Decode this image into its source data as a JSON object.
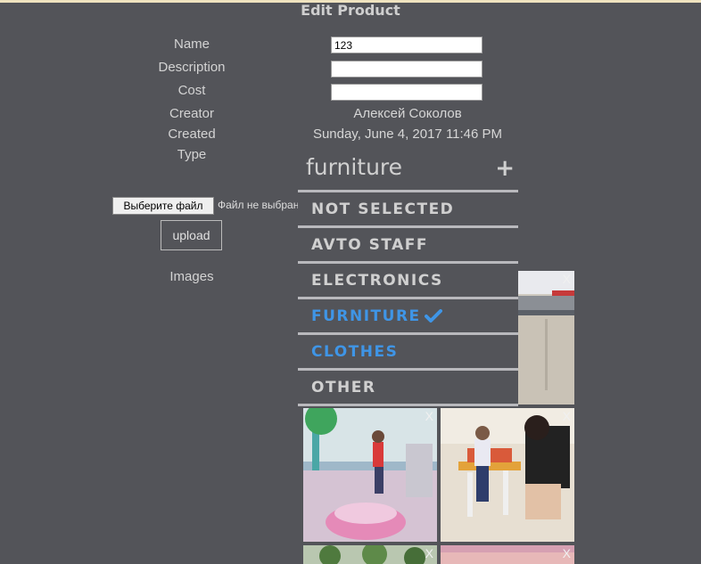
{
  "page": {
    "title": "Edit Product"
  },
  "form": {
    "name_label": "Name",
    "name_value": "123",
    "description_label": "Description",
    "description_value": "",
    "cost_label": "Cost",
    "cost_value": "",
    "creator_label": "Creator",
    "creator_value": "Алексей Соколов",
    "created_label": "Created",
    "created_value": "Sunday, June 4, 2017 11:46 PM",
    "type_label": "Type",
    "images_label": "Images"
  },
  "file": {
    "button_label": "Выберите файл",
    "status_text": "Файл не выбран",
    "upload_label": "upload"
  },
  "type_dropdown": {
    "selected": "furniture",
    "plus_icon": "plus-icon",
    "items": [
      {
        "label": "NOT SELECTED",
        "active": false
      },
      {
        "label": "AVTO STAFF",
        "active": false
      },
      {
        "label": "ELECTRONICS",
        "active": false
      },
      {
        "label": "FURNITURE",
        "active": true
      },
      {
        "label": "CLOTHES",
        "active": false
      },
      {
        "label": "OTHER",
        "active": false
      }
    ],
    "accent_color": "#3f95e6"
  },
  "images": {
    "remove_label": "X"
  }
}
